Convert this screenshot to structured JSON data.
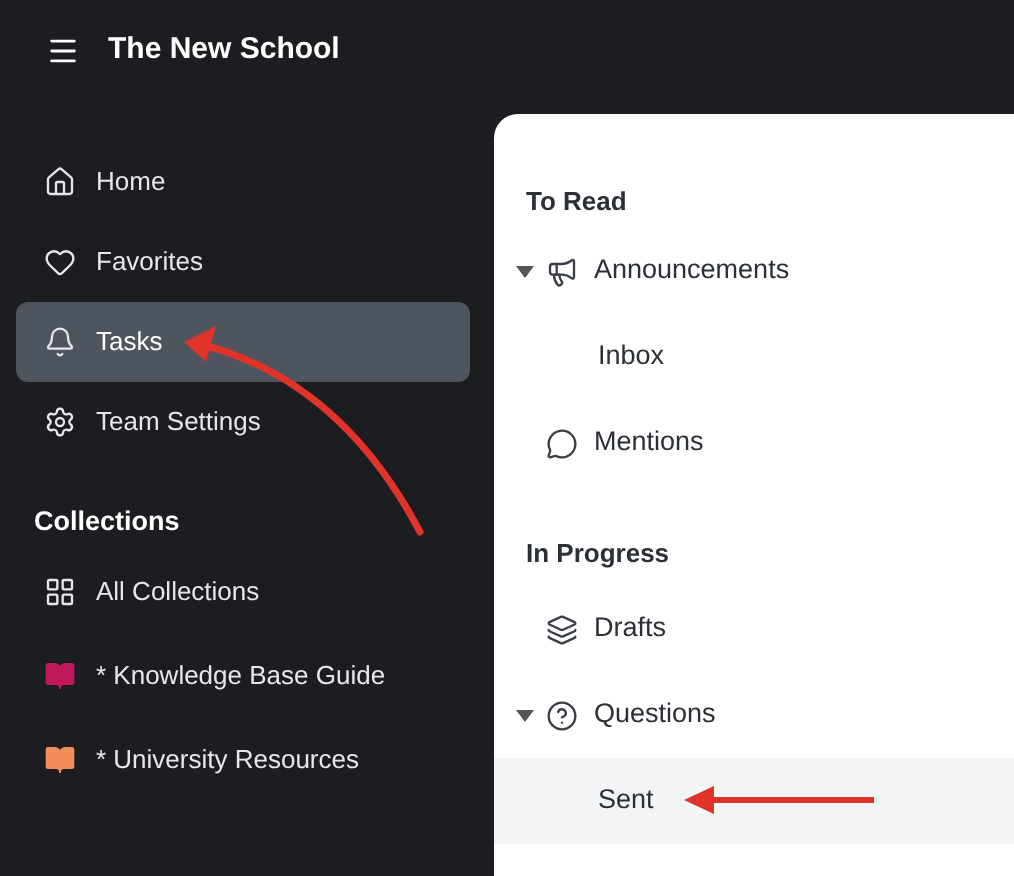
{
  "header": {
    "title": "The New School"
  },
  "sidebar": {
    "items": [
      {
        "kind": "home",
        "label": "Home",
        "selected": false
      },
      {
        "kind": "heart",
        "label": "Favorites",
        "selected": false
      },
      {
        "kind": "bell",
        "label": "Tasks",
        "selected": true
      },
      {
        "kind": "gear",
        "label": "Team Settings",
        "selected": false
      }
    ],
    "collections": {
      "title": "Collections",
      "items": [
        {
          "kind": "grid",
          "label": "All Collections",
          "selected": false
        },
        {
          "kind": "book",
          "label": "* Knowledge Base Guide",
          "color": "#c0185a",
          "selected": false
        },
        {
          "kind": "book",
          "label": "* University Resources",
          "color": "#f28c5b",
          "selected": false
        }
      ]
    }
  },
  "panel": {
    "sections": [
      {
        "title": "To Read",
        "items": [
          {
            "kind": "megaphone",
            "label": "Announcements",
            "expanded": true,
            "selected": false,
            "children": [
              {
                "label": "Inbox",
                "selected": false
              }
            ]
          },
          {
            "kind": "chat",
            "label": "Mentions",
            "selected": false
          }
        ]
      },
      {
        "title": "In Progress",
        "items": [
          {
            "kind": "layers",
            "label": "Drafts",
            "selected": false
          },
          {
            "kind": "help",
            "label": "Questions",
            "expanded": true,
            "selected": false,
            "children": [
              {
                "label": "Sent",
                "selected": true
              }
            ]
          }
        ]
      }
    ]
  }
}
